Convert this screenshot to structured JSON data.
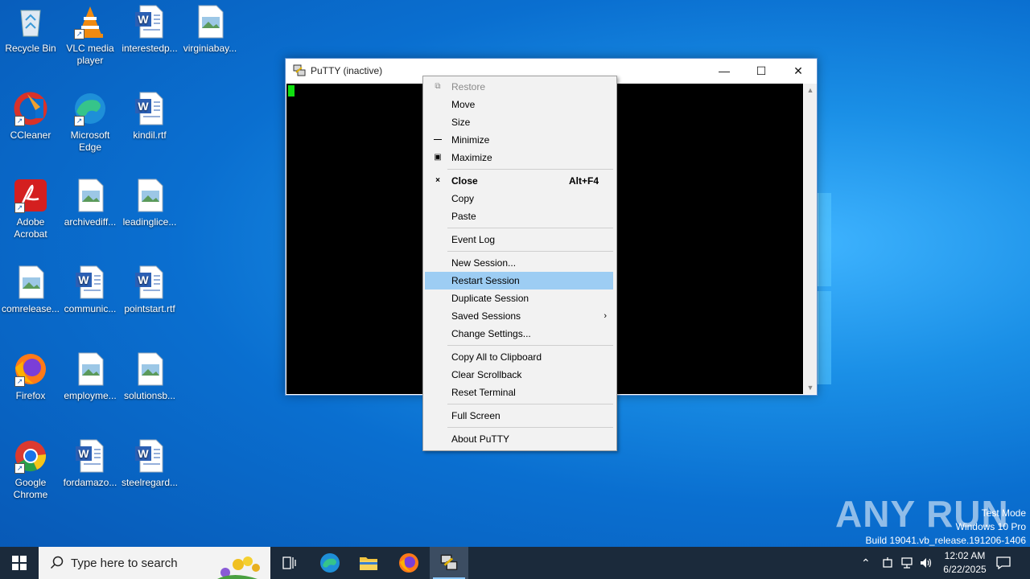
{
  "desktop": {
    "icons": [
      {
        "label": "Recycle Bin",
        "icon": "recycle-bin-icon"
      },
      {
        "label": "VLC media player",
        "icon": "vlc-icon"
      },
      {
        "label": "interestedp...",
        "icon": "word-doc-icon"
      },
      {
        "label": "virginiabay...",
        "icon": "image-file-icon"
      },
      {
        "label": "CCleaner",
        "icon": "ccleaner-icon"
      },
      {
        "label": "Microsoft Edge",
        "icon": "edge-icon"
      },
      {
        "label": "kindil.rtf",
        "icon": "word-doc-icon"
      },
      {
        "label": "Adobe Acrobat",
        "icon": "acrobat-icon"
      },
      {
        "label": "archivediff...",
        "icon": "image-file-icon"
      },
      {
        "label": "leadinglice...",
        "icon": "image-file-icon"
      },
      {
        "label": "comrelease...",
        "icon": "image-file-icon"
      },
      {
        "label": "communic...",
        "icon": "word-doc-icon"
      },
      {
        "label": "pointstart.rtf",
        "icon": "word-doc-icon"
      },
      {
        "label": "Firefox",
        "icon": "firefox-icon"
      },
      {
        "label": "employme...",
        "icon": "image-file-icon"
      },
      {
        "label": "solutionsb...",
        "icon": "image-file-icon"
      },
      {
        "label": "Google Chrome",
        "icon": "chrome-icon"
      },
      {
        "label": "fordamazo...",
        "icon": "word-doc-icon"
      },
      {
        "label": "steelregard...",
        "icon": "word-doc-icon"
      }
    ]
  },
  "putty": {
    "title": "PuTTY (inactive)",
    "minimize": "—",
    "maximize": "☐",
    "close": "✕"
  },
  "menu": {
    "restore": "Restore",
    "move": "Move",
    "size": "Size",
    "minimize": "Minimize",
    "maximize": "Maximize",
    "close": "Close",
    "close_accel": "Alt+F4",
    "copy": "Copy",
    "paste": "Paste",
    "event_log": "Event Log",
    "new_session": "New Session...",
    "restart_session": "Restart Session",
    "duplicate_session": "Duplicate Session",
    "saved_sessions": "Saved Sessions",
    "change_settings": "Change Settings...",
    "copy_all": "Copy All to Clipboard",
    "clear_scrollback": "Clear Scrollback",
    "reset_terminal": "Reset Terminal",
    "full_screen": "Full Screen",
    "about": "About PuTTY"
  },
  "taskbar": {
    "search_placeholder": "Type here to search",
    "time": "12:02 AM",
    "date": "6/22/2025"
  },
  "watermark": {
    "brand": "ANY RUN",
    "line1": "Test Mode",
    "line2": "Windows 10 Pro",
    "line3": "Build 19041.vb_release.191206-1406"
  }
}
